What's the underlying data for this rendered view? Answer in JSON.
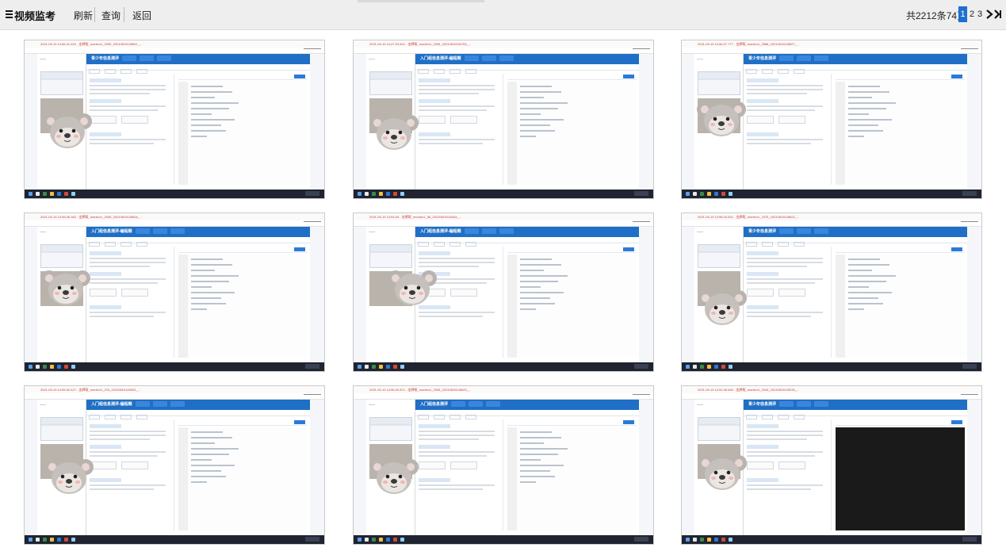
{
  "header": {
    "title": "视频监考",
    "nav": {
      "refresh": "刷新",
      "query": "查询",
      "back": "返回"
    }
  },
  "pager": {
    "summary": "共2212条74页",
    "current": "1",
    "pages": [
      "2",
      "3"
    ]
  },
  "tiles": [
    {
      "status": "2021-09-19 14:56:41.532 - 金牌帮_monitor1_2090_20210819145641_...",
      "app": "青少年信息测评"
    },
    {
      "status": "2021-09-19 14:47:23.841 - 金牌帮_monitor1_2005_20210819154752_...",
      "app": "入门组信息测评-编程题"
    },
    {
      "status": "2021-09-19 14:56:27.777 - 金牌帮_monitor1_2588_20210819145627_...",
      "app": "青少年信息测评"
    },
    {
      "status": "2021-09-19 14:56:26.362 - 金牌帮_monitor1_2005_20210819145626_...",
      "app": "入门组信息测评-编程题"
    },
    {
      "status": "2021-09-19 14:54:44 - 金牌帮_monitor1_56_20210819145444_...",
      "app": "入门组信息测评-编程题"
    },
    {
      "status": "2021-09-19 14:56:24.601 - 金牌帮_monitor1_2375_20210819145624_...",
      "app": "青少年信息测评"
    },
    {
      "status": "2021-09-19 14:55:32.427 - 金牌帮_monitor1_215_20210819145532_...",
      "app": "入门组信息测评-编程题"
    },
    {
      "status": "2021-09-19 14:56:20.871 - 金牌帮_monitor1_2005_20210819145620_...",
      "app": "入门组信息测评"
    },
    {
      "status": "2021-09-19 14:52:39.890 - 金牌帮_monitor1_2049_20210819145239_...",
      "app": "青少年信息测评"
    }
  ],
  "colors": {
    "accent": "#1e6fd0",
    "app_header": "#1f6fc6",
    "taskbar": "#1f2430"
  }
}
